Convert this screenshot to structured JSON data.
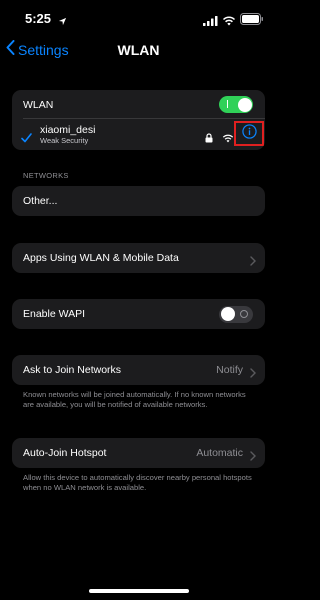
{
  "status_bar": {
    "time": "5:25"
  },
  "nav": {
    "back_label": "Settings",
    "title": "WLAN"
  },
  "wlan_group": {
    "toggle_label": "WLAN",
    "toggle_on": true,
    "connected_network": {
      "name": "xiaomi_desi",
      "security": "Weak Security"
    }
  },
  "networks_section": {
    "header": "NETWORKS",
    "other_label": "Other..."
  },
  "apps_using": {
    "label": "Apps Using WLAN & Mobile Data"
  },
  "wapi": {
    "label": "Enable WAPI",
    "toggle_on": false
  },
  "ask_to_join": {
    "label": "Ask to Join Networks",
    "value": "Notify",
    "footnote": "Known networks will be joined automatically. If no known networks are available, you will be notified of available networks."
  },
  "auto_join": {
    "label": "Auto-Join Hotspot",
    "value": "Automatic",
    "footnote": "Allow this device to automatically discover nearby personal hotspots when no WLAN network is available."
  },
  "colors": {
    "accent": "#0a84ff",
    "toggle_on": "#30d158",
    "highlight_box": "#e02020",
    "cell_background": "#1c1c1e"
  }
}
